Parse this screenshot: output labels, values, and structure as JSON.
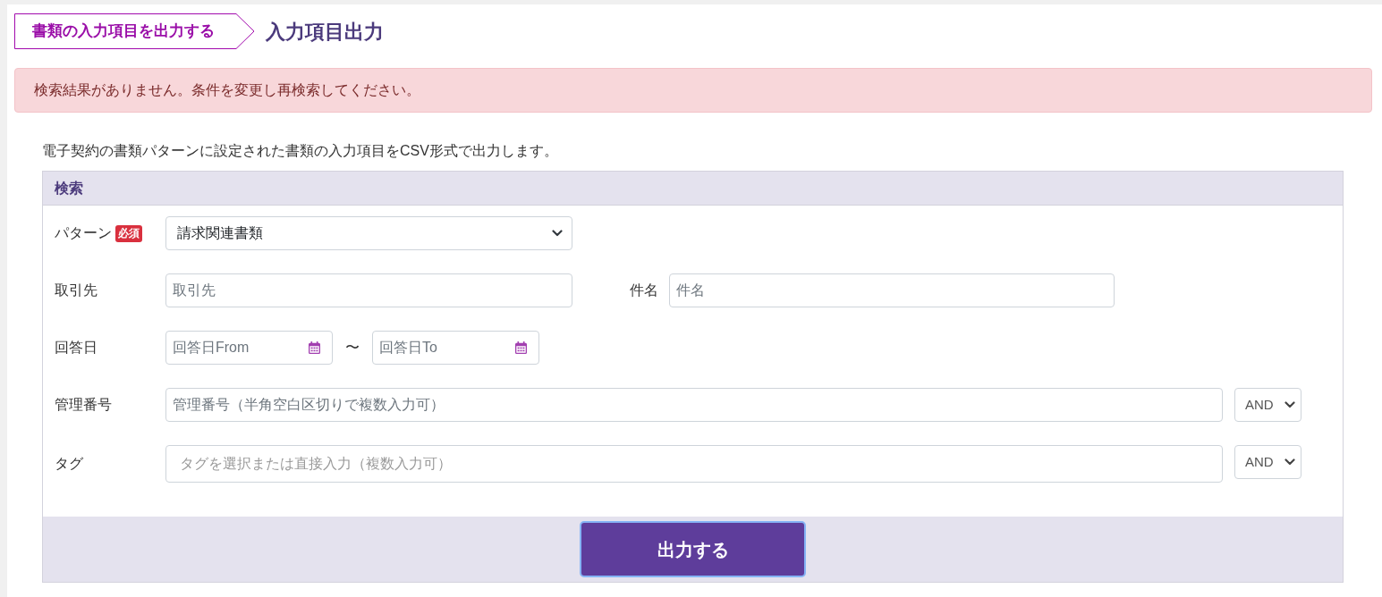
{
  "breadcrumb": {
    "label": "書類の入力項目を出力する"
  },
  "page_title": "入力項目出力",
  "alert": {
    "message": "検索結果がありません。条件を変更し再検索してください。"
  },
  "description": "電子契約の書類パターンに設定された書類の入力項目をCSV形式で出力します。",
  "search_panel": {
    "title": "検索",
    "rows": [
      {
        "label": "パターン",
        "required_badge": "必須",
        "fields": [
          {
            "kind": "select",
            "value": "請求関連書類"
          }
        ]
      },
      {
        "label": "取引先",
        "fields": [
          {
            "kind": "text",
            "placeholder": "取引先"
          },
          {
            "kind": "label",
            "text": "件名"
          },
          {
            "kind": "text",
            "placeholder": "件名"
          }
        ]
      },
      {
        "label": "回答日",
        "fields": [
          {
            "kind": "date",
            "placeholder": "回答日From"
          },
          {
            "kind": "separator",
            "text": "〜"
          },
          {
            "kind": "date",
            "placeholder": "回答日To"
          }
        ]
      },
      {
        "label": "管理番号",
        "fields": [
          {
            "kind": "text",
            "placeholder": "管理番号（半角空白区切りで複数入力可）"
          },
          {
            "kind": "operator",
            "value": "AND"
          }
        ]
      },
      {
        "label": "タグ",
        "fields": [
          {
            "kind": "tags",
            "placeholder": "タグを選択または直接入力（複数入力可）"
          },
          {
            "kind": "operator",
            "value": "AND"
          }
        ]
      }
    ],
    "submit_button": "出力する"
  }
}
